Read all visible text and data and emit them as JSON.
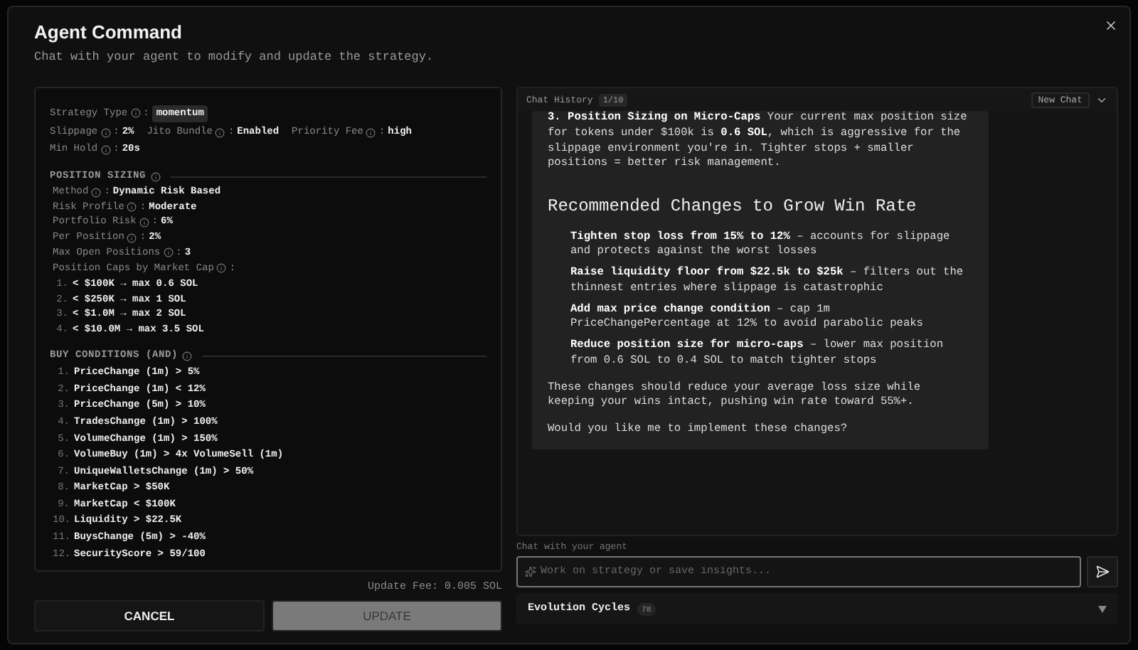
{
  "dialog": {
    "title": "Agent Command",
    "subtitle": "Chat with your agent to modify and update the strategy."
  },
  "strategy": {
    "rows": [
      [
        {
          "label": "Strategy Type",
          "sep": ":",
          "value": "momentum",
          "kind": "chip"
        }
      ],
      [
        {
          "label": "Slippage",
          "sep": ":",
          "value": "2%",
          "kind": "plain"
        },
        {
          "label": "Jito Bundle",
          "sep": ":",
          "value": "Enabled",
          "kind": "plain"
        },
        {
          "label": "Priority Fee",
          "sep": ":",
          "value": "high",
          "kind": "plain"
        }
      ],
      [
        {
          "label": "Min Hold",
          "sep": ":",
          "value": "20s",
          "kind": "plain"
        }
      ]
    ]
  },
  "position_sizing": {
    "heading": "POSITION SIZING",
    "fields": [
      {
        "label": "Method",
        "sep": ":",
        "value": "Dynamic Risk Based"
      },
      {
        "label": "Risk Profile",
        "sep": ":",
        "value": "Moderate"
      },
      {
        "label": "Portfolio Risk",
        "sep": ":",
        "value": "6%"
      },
      {
        "label": "Per Position",
        "sep": ":",
        "value": "2%"
      },
      {
        "label": "Max Open Positions",
        "sep": ":",
        "value": "3"
      }
    ],
    "caps_label": "Position Caps by Market Cap",
    "caps_sep": ":",
    "caps": [
      {
        "number": "1.",
        "text": "< $100K → max 0.6 SOL"
      },
      {
        "number": "2.",
        "text": "< $250K → max 1 SOL"
      },
      {
        "number": "3.",
        "text": "< $1.0M → max 2 SOL"
      },
      {
        "number": "4.",
        "text": "< $10.0M → max 3.5 SOL"
      }
    ]
  },
  "buy_conditions": {
    "heading": "BUY CONDITIONS (AND)",
    "items": [
      {
        "number": "1.",
        "text": "PriceChange (1m) > 5%"
      },
      {
        "number": "2.",
        "text": "PriceChange (1m) < 12%"
      },
      {
        "number": "3.",
        "text": "PriceChange (5m) > 10%"
      },
      {
        "number": "4.",
        "text": "TradesChange (1m) > 100%"
      },
      {
        "number": "5.",
        "text": "VolumeChange (1m) > 150%"
      },
      {
        "number": "6.",
        "text": "VolumeBuy (1m) > 4x VolumeSell (1m)"
      },
      {
        "number": "7.",
        "text": "UniqueWalletsChange (1m) > 50%"
      },
      {
        "number": "8.",
        "text": "MarketCap > $50K"
      },
      {
        "number": "9.",
        "text": "MarketCap < $100K"
      },
      {
        "number": "10.",
        "text": "Liquidity > $22.5K"
      },
      {
        "number": "11.",
        "text": "BuysChange (5m) > -40%"
      },
      {
        "number": "12.",
        "text": "SecurityScore > 59/100"
      }
    ]
  },
  "update_fee": "Update Fee: 0.005 SOL",
  "buttons": [
    {
      "label": "CANCEL",
      "kind": "secondary",
      "disabled": false
    },
    {
      "label": "UPDATE",
      "kind": "primary",
      "disabled": true
    }
  ],
  "chat": {
    "title": "Chat History",
    "counter": "1/10",
    "new_chat": "New Chat",
    "blocks": [
      {
        "kind": "paragraph",
        "text": "**3. Position Sizing on Micro-Caps** Your current max position size for tokens under $100k is **0.6 SOL**, which is aggressive for the slippage environment you're in. Tighter stops + smaller positions = better risk management."
      },
      {
        "kind": "heading",
        "text": "Recommended Changes to Grow Win Rate"
      },
      {
        "kind": "list",
        "items": [
          "**Tighten stop loss from 15% to 12%** – accounts for slippage and protects against the worst losses",
          "**Raise liquidity floor from $22.5k to $25k** – filters out the thinnest entries where slippage is catastrophic",
          "**Add max price change condition** – cap 1m PriceChangePercentage at 12% to avoid parabolic peaks",
          "**Reduce position size for micro-caps** – lower max position from 0.6 SOL to 0.4 SOL to match tighter stops"
        ]
      },
      {
        "kind": "paragraph",
        "text": "These changes should reduce your average loss size while keeping your wins intact, pushing win rate toward 55%+."
      },
      {
        "kind": "paragraph",
        "text": "Would you like me to implement these changes?"
      }
    ],
    "input_label": "Chat with your agent",
    "placeholder": "Work on strategy or save insights..."
  },
  "evolution": {
    "label": "Evolution Cycles",
    "count": "78",
    "expanded": false
  }
}
